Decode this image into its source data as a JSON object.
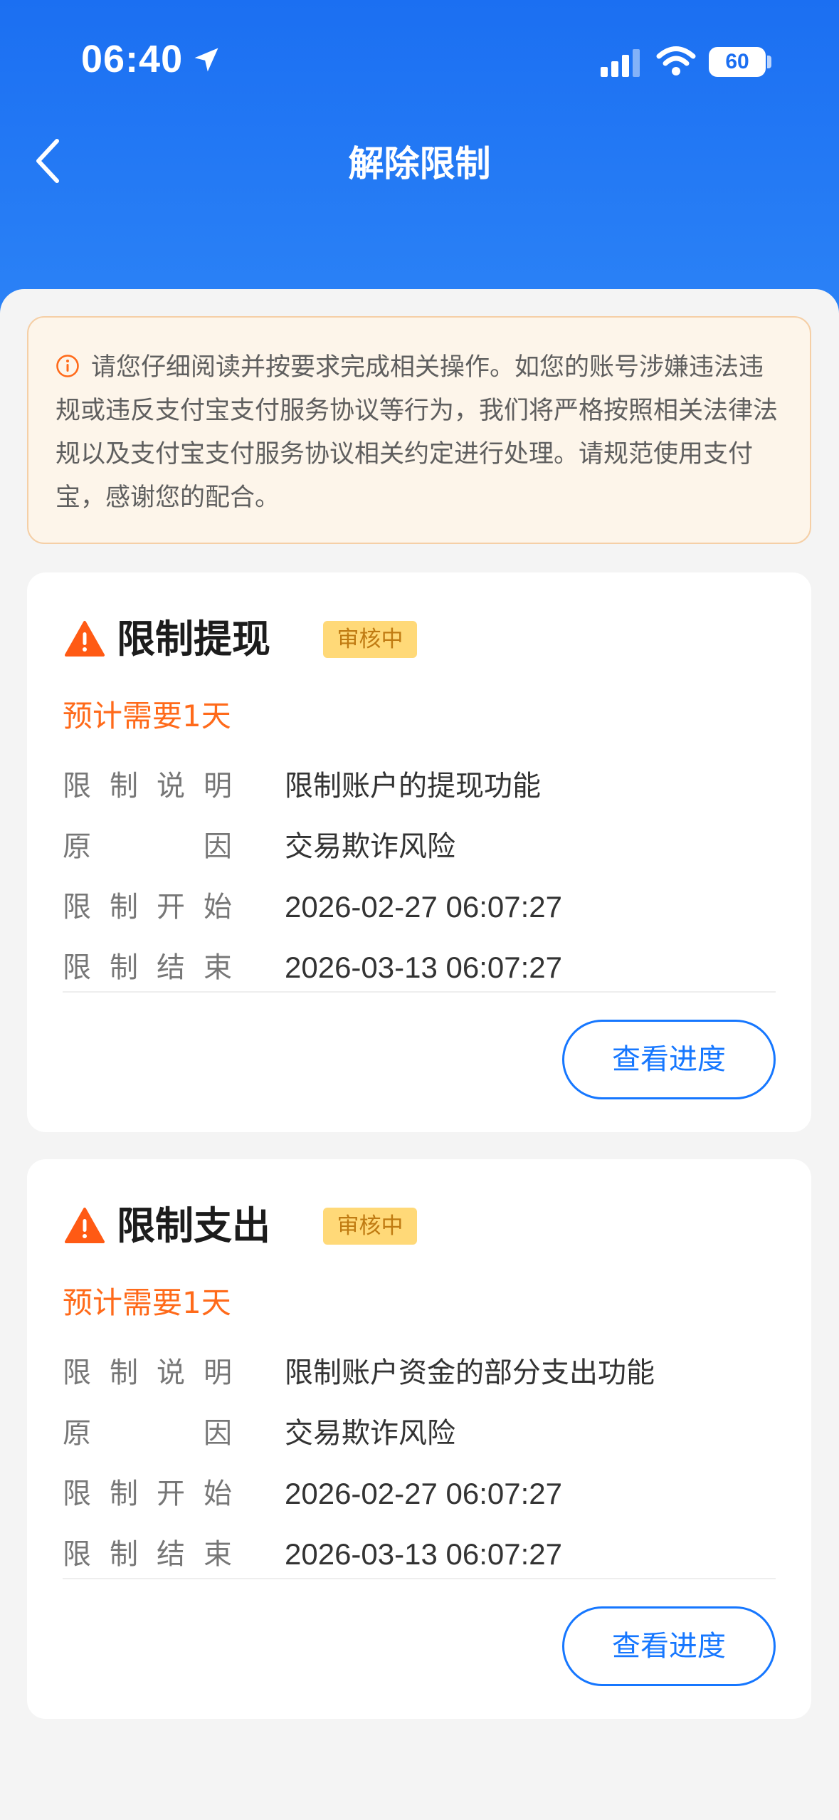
{
  "status_bar": {
    "time": "06:40",
    "battery": "60"
  },
  "nav": {
    "title": "解除限制"
  },
  "notice": {
    "text": "请您仔细阅读并按要求完成相关操作。如您的账号涉嫌违法违规或违反支付宝支付服务协议等行为，我们将严格按照相关法律法规以及支付宝支付服务协议相关约定进行处理。请规范使用支付宝，感谢您的配合。"
  },
  "cards": [
    {
      "title": "限制提现",
      "badge": "审核中",
      "estimate": "预计需要1天",
      "rows": [
        {
          "label": "限制说明",
          "value": "限制账户的提现功能"
        },
        {
          "label": "原因",
          "value": "交易欺诈风险"
        },
        {
          "label": "限制开始",
          "value": "2026-02-27 06:07:27"
        },
        {
          "label": "限制结束",
          "value": "2026-03-13 06:07:27"
        }
      ],
      "button": "查看进度"
    },
    {
      "title": "限制支出",
      "badge": "审核中",
      "estimate": "预计需要1天",
      "rows": [
        {
          "label": "限制说明",
          "value": "限制账户资金的部分支出功能"
        },
        {
          "label": "原因",
          "value": "交易欺诈风险"
        },
        {
          "label": "限制开始",
          "value": "2026-02-27 06:07:27"
        },
        {
          "label": "限制结束",
          "value": "2026-03-13 06:07:27"
        }
      ],
      "button": "查看进度"
    }
  ],
  "colors": {
    "brand_blue": "#1677ff",
    "warning_orange": "#ff6a1a",
    "badge_bg": "#ffd978"
  }
}
